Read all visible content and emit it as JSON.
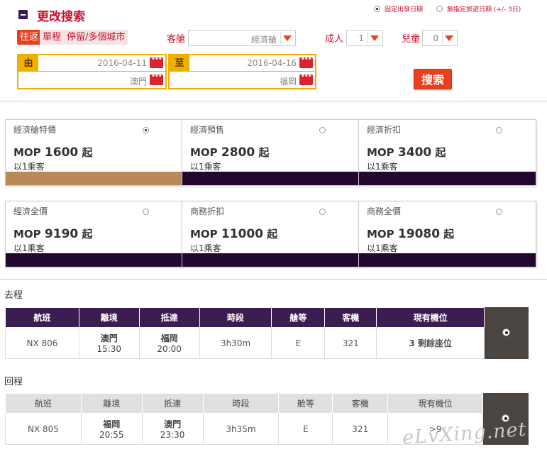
{
  "search": {
    "title": "更改搜索",
    "date_mode": {
      "fixed_label": "固定出發日期",
      "flexible_label": "無指定旅遊日期 (+/- 3日)"
    },
    "trip_types": [
      "往返",
      "單程",
      "停留/多個城市"
    ],
    "cabin_label": "客艙",
    "cabin_value": "經濟艙",
    "adult_label": "成人",
    "adult_value": "1",
    "child_label": "兒童",
    "child_value": "0",
    "from_tag": "由",
    "to_tag": "至",
    "depart_date": "2016-04-11",
    "return_date": "2016-04-16",
    "origin": "澳門",
    "destination": "福岡",
    "search_button": "搜索",
    "accent_color": "#e8401c"
  },
  "fares": [
    {
      "name": "經濟艙特價",
      "currency": "MOP",
      "price": "1600",
      "suffix": "起",
      "pax": "以1乘客",
      "selected": true
    },
    {
      "name": "經濟預售",
      "currency": "MOP",
      "price": "2800",
      "suffix": "起",
      "pax": "以1乘客",
      "selected": false
    },
    {
      "name": "經濟折扣",
      "currency": "MOP",
      "price": "3400",
      "suffix": "起",
      "pax": "以1乘客",
      "selected": false
    },
    {
      "name": "經濟全價",
      "currency": "MOP",
      "price": "9190",
      "suffix": "起",
      "pax": "以1乘客",
      "selected": false
    },
    {
      "name": "商務折扣",
      "currency": "MOP",
      "price": "11000",
      "suffix": "起",
      "pax": "以1乘客",
      "selected": false
    },
    {
      "name": "商務全價",
      "currency": "MOP",
      "price": "19080",
      "suffix": "起",
      "pax": "以1乘客",
      "selected": false
    }
  ],
  "outbound": {
    "title": "去程",
    "headers": [
      "航班",
      "離境",
      "抵達",
      "時段",
      "艙等",
      "客機",
      "現有機位"
    ],
    "flight": "NX 806",
    "depart_city": "澳門",
    "depart_time": "15:30",
    "arrive_city": "福岡",
    "arrive_time": "20:00",
    "duration": "3h30m",
    "cabin": "E",
    "aircraft": "321",
    "seats": "3 剩餘座位"
  },
  "return": {
    "title": "回程",
    "headers": [
      "航班",
      "離境",
      "抵達",
      "時段",
      "舱等",
      "客機",
      "現有機位"
    ],
    "flight": "NX 805",
    "depart_city": "福岡",
    "depart_time": "20:55",
    "arrive_city": "澳門",
    "arrive_time": "23:30",
    "duration": "3h35m",
    "cabin": "E",
    "aircraft": "321",
    "seats": ">9"
  },
  "watermark": "eLvXing.net"
}
